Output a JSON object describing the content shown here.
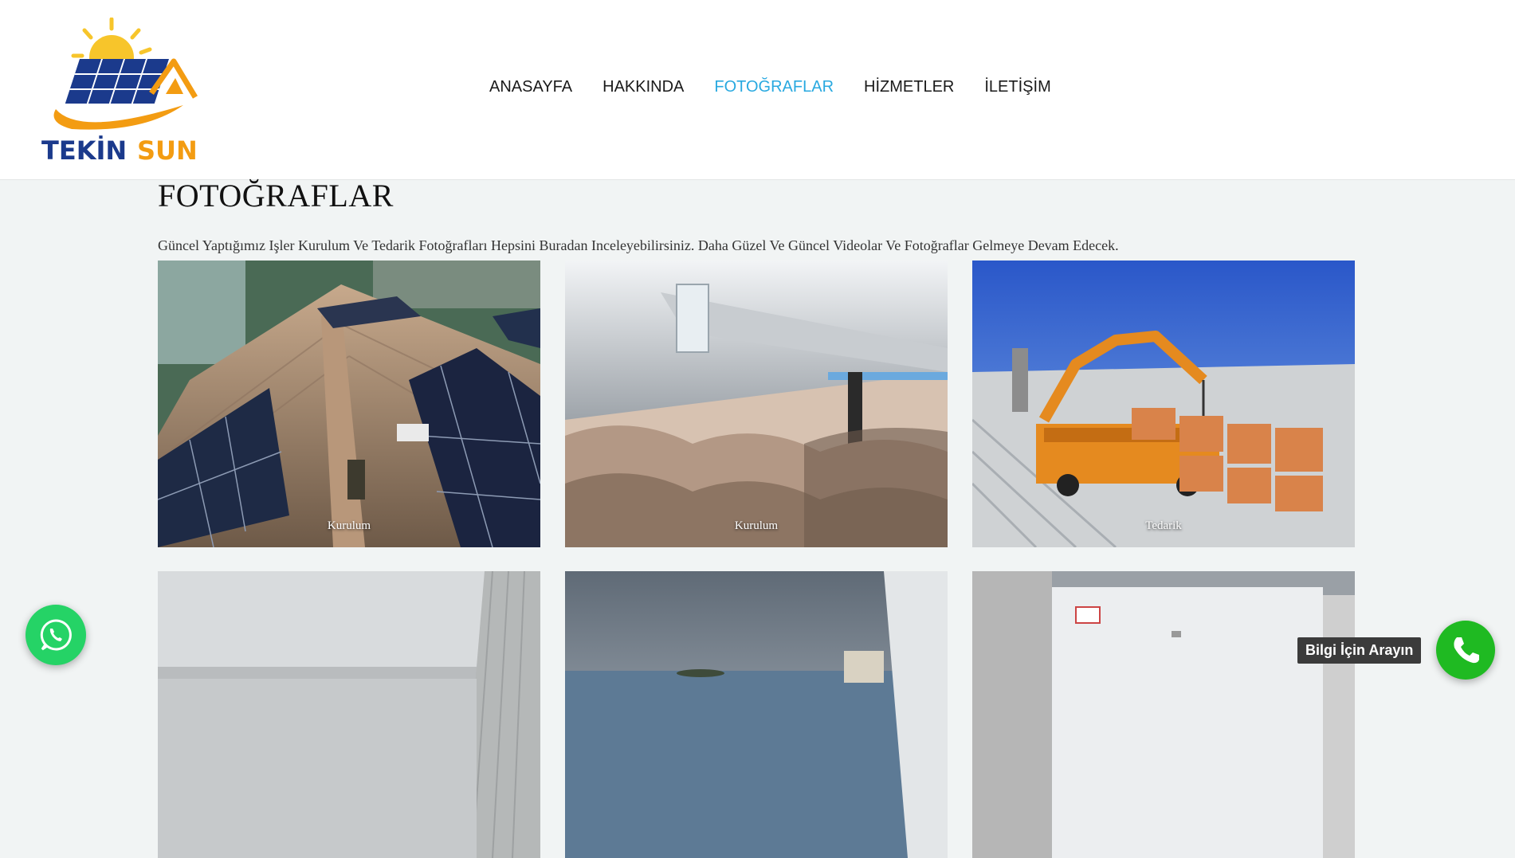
{
  "brand": {
    "logo_text_primary": "TEKİN",
    "logo_text_secondary": "SUN",
    "colors": {
      "navy": "#1b3a8c",
      "orange": "#f39c12",
      "sun": "#f7c52b"
    }
  },
  "nav": {
    "items": [
      {
        "label": "ANASAYFA",
        "active": false
      },
      {
        "label": "HAKKINDA",
        "active": false
      },
      {
        "label": "FOTOĞRAFLAR",
        "active": true
      },
      {
        "label": "HİZMETLER",
        "active": false
      },
      {
        "label": "İLETİŞİM",
        "active": false
      }
    ],
    "active_color": "#29a9e0"
  },
  "page": {
    "title": "FOTOĞRAFLAR",
    "intro": "Güncel Yaptığımız Işler Kurulum Ve Tedarik Fotoğrafları Hepsini Buradan Inceleyebilirsiniz. Daha Güzel Ve Güncel Videolar Ve Fotoğraflar Gelmeye Devam Edecek."
  },
  "gallery": [
    {
      "caption": "Kurulum",
      "scene": "roof-solar-panels"
    },
    {
      "caption": "Kurulum",
      "scene": "mounting-rail-closeup"
    },
    {
      "caption": "Tedarik",
      "scene": "crane-truck-delivery"
    },
    {
      "caption": "",
      "scene": "hazy-rooftop"
    },
    {
      "caption": "",
      "scene": "sea-view-roof"
    },
    {
      "caption": "",
      "scene": "inverter-box"
    }
  ],
  "floating": {
    "whatsapp_icon": "whatsapp-icon",
    "call_label": "Bilgi İçin Arayın",
    "call_icon": "phone-icon"
  }
}
